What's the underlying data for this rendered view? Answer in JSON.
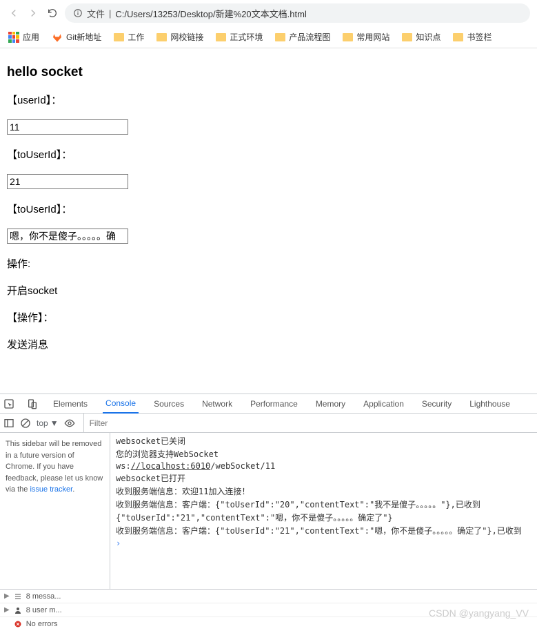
{
  "browser": {
    "address_prefix": "文件",
    "url": "C:/Users/13253/Desktop/新建%20文本文档.html"
  },
  "bookmarks": {
    "apps": "应用",
    "items": [
      "Git新地址",
      "工作",
      "网校链接",
      "正式环境",
      "产品流程图",
      "常用网站",
      "知识点",
      "书签栏"
    ]
  },
  "page": {
    "heading": "hello socket",
    "label1": "【userId】：",
    "input1": "11",
    "label2": "【toUserId】：",
    "input2": "21",
    "label3": "【toUserId】：",
    "input3": "嗯，你不是傻子。。。。。确",
    "label4": "操作:",
    "action1": "开启socket",
    "label5": "【操作】：",
    "action2": "发送消息"
  },
  "devtools": {
    "tabs": [
      "Elements",
      "Console",
      "Sources",
      "Network",
      "Performance",
      "Memory",
      "Application",
      "Security",
      "Lighthouse"
    ],
    "active_tab": "Console",
    "context": "top",
    "filter_placeholder": "Filter",
    "sidebar_note": "This sidebar will be removed in a future version of Chrome. If you have feedback, please let us know via the ",
    "sidebar_link": "issue tracker",
    "console_lines": [
      "websocket已关闭",
      "您的浏览器支持WebSocket",
      "ws://localhost:6010/webSocket/11",
      "websocket已打开",
      "收到服务端信息：欢迎11加入连接！",
      "收到服务端信息：客户端：{\"toUserId\":\"20\",\"contentText\":\"我不是傻子。。。。。\"},已收到",
      "{\"toUserId\":\"21\",\"contentText\":\"嗯，你不是傻子。。。。。确定了\"}",
      "收到服务端信息：客户端：{\"toUserId\":\"21\",\"contentText\":\"嗯，你不是傻子。。。。。确定了\"},已收到"
    ],
    "footer": {
      "messages": "8 messa...",
      "user": "8 user m...",
      "errors": "No errors"
    }
  },
  "watermark": "CSDN @yangyang_VV"
}
